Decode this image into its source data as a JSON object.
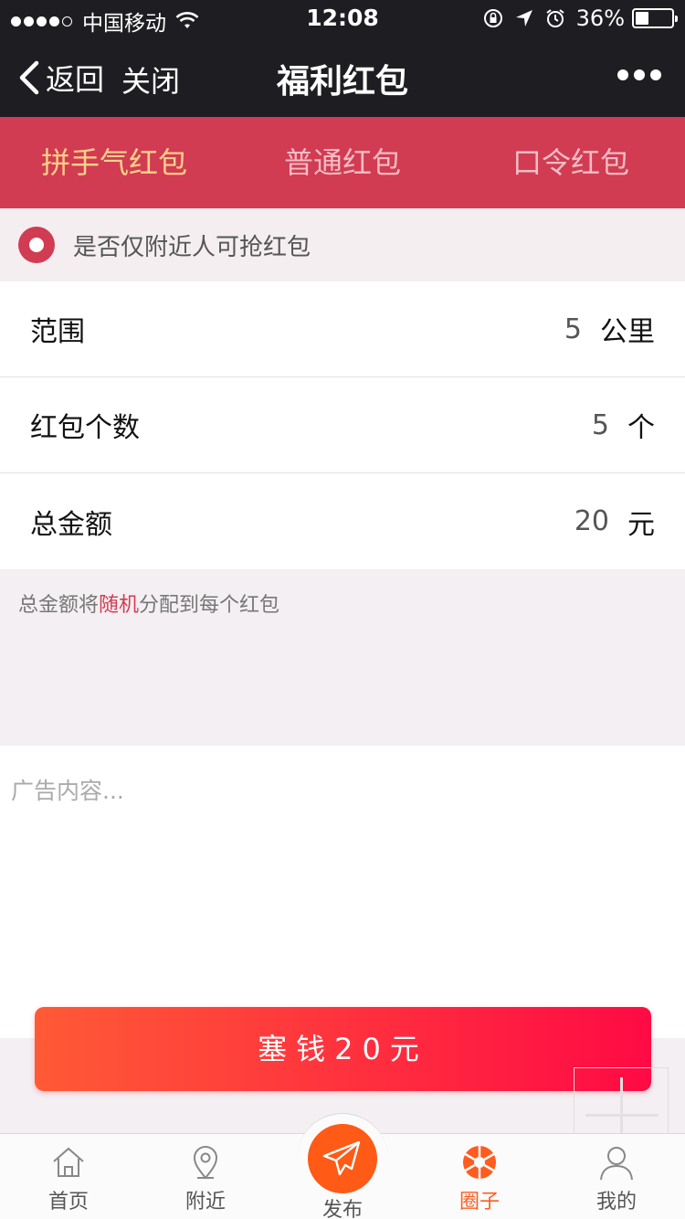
{
  "status_bar": {
    "carrier": "中国移动",
    "time": "12:08",
    "battery": "36%",
    "battery_level": 0.36,
    "signal_bars": 4
  },
  "nav": {
    "back_label": "返回",
    "close_label": "关闭",
    "title": "福利红包"
  },
  "tabs": [
    {
      "label": "拼手气红包",
      "active": true
    },
    {
      "label": "普通红包",
      "active": false
    },
    {
      "label": "口令红包",
      "active": false
    }
  ],
  "nearby_option": {
    "label": "是否仅附近人可抢红包",
    "checked": true
  },
  "form": {
    "range": {
      "label": "范围",
      "value": "5",
      "unit": "公里"
    },
    "count": {
      "label": "红包个数",
      "value": "5",
      "unit": "个"
    },
    "amount": {
      "label": "总金额",
      "value": "20",
      "unit": "元"
    }
  },
  "note": {
    "prefix": "总金额将",
    "highlight": "随机",
    "suffix": "分配到每个红包"
  },
  "ad": {
    "placeholder": "广告内容..."
  },
  "pay_button": {
    "label": "塞钱20元"
  },
  "tabbar": {
    "items": [
      {
        "label": "首页",
        "icon": "home-icon",
        "active": false
      },
      {
        "label": "附近",
        "icon": "location-pin-icon",
        "active": false
      },
      {
        "label": "发布",
        "icon": "paper-plane-icon",
        "active": false
      },
      {
        "label": "圈子",
        "icon": "aperture-icon",
        "active": true
      },
      {
        "label": "我的",
        "icon": "user-icon",
        "active": false
      }
    ]
  },
  "colors": {
    "brand_red": "#d13c52",
    "active_tab_text": "#ffd08a",
    "accent_orange": "#ff5a16",
    "button_gradient_start": "#ff5a36",
    "button_gradient_end": "#ff0a45"
  }
}
